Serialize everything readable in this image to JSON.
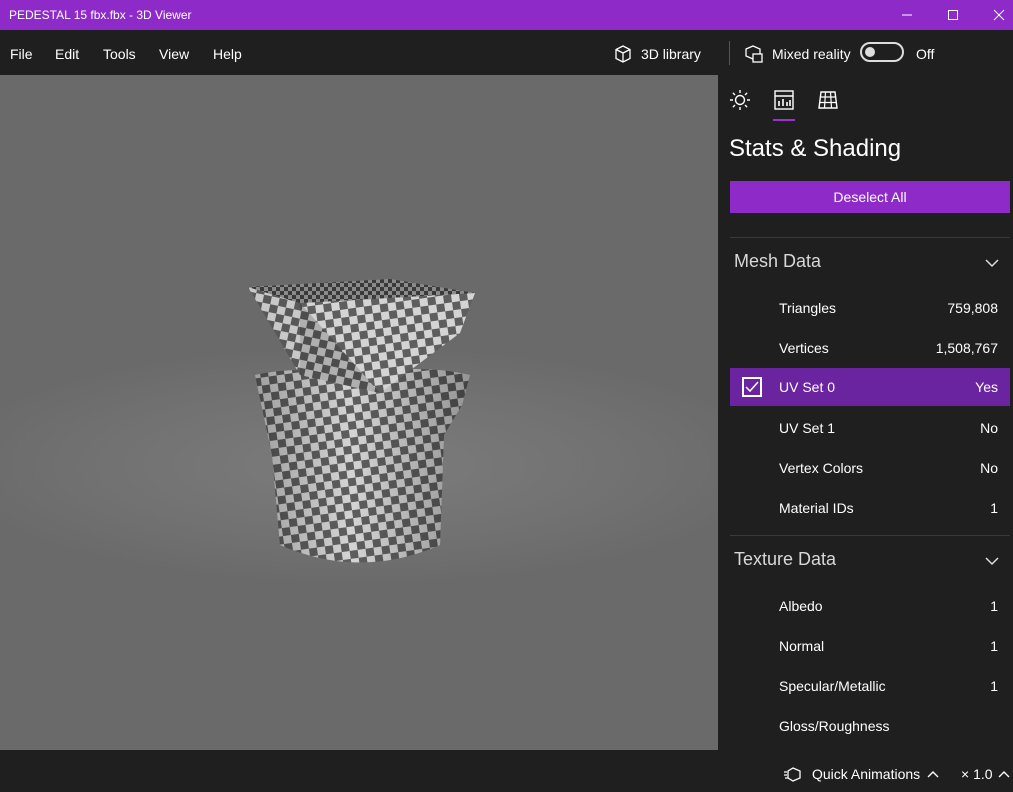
{
  "window": {
    "title": "PEDESTAL 15 fbx.fbx - 3D Viewer",
    "controls": [
      "minimize",
      "maximize",
      "close"
    ]
  },
  "menu": {
    "items": [
      "File",
      "Edit",
      "Tools",
      "View",
      "Help"
    ]
  },
  "toolbar": {
    "library_label": "3D library",
    "mixed_reality_label": "Mixed reality",
    "mixed_reality_state": "Off"
  },
  "panel": {
    "title": "Stats & Shading",
    "deselect_label": "Deselect All",
    "tabs": [
      "lighting-icon",
      "stats-icon",
      "grid-icon"
    ],
    "mesh": {
      "header": "Mesh Data",
      "rows": [
        {
          "label": "Triangles",
          "value": "759,808"
        },
        {
          "label": "Vertices",
          "value": "1,508,767"
        },
        {
          "label": "UV Set 0",
          "value": "Yes",
          "selected": true
        },
        {
          "label": "UV Set 1",
          "value": "No"
        },
        {
          "label": "Vertex Colors",
          "value": "No"
        },
        {
          "label": "Material IDs",
          "value": "1"
        }
      ]
    },
    "texture": {
      "header": "Texture Data",
      "rows": [
        {
          "label": "Albedo",
          "value": "1"
        },
        {
          "label": "Normal",
          "value": "1"
        },
        {
          "label": "Specular/Metallic",
          "value": "1"
        },
        {
          "label": "Gloss/Roughness",
          "value": ""
        }
      ]
    }
  },
  "status": {
    "quick_animations_label": "Quick Animations",
    "speed_label": "× 1.0"
  },
  "colors": {
    "accent": "#8e2bc8",
    "selected_row": "#6a24a0",
    "background": "#1f1f1f",
    "viewport": "#727272"
  }
}
